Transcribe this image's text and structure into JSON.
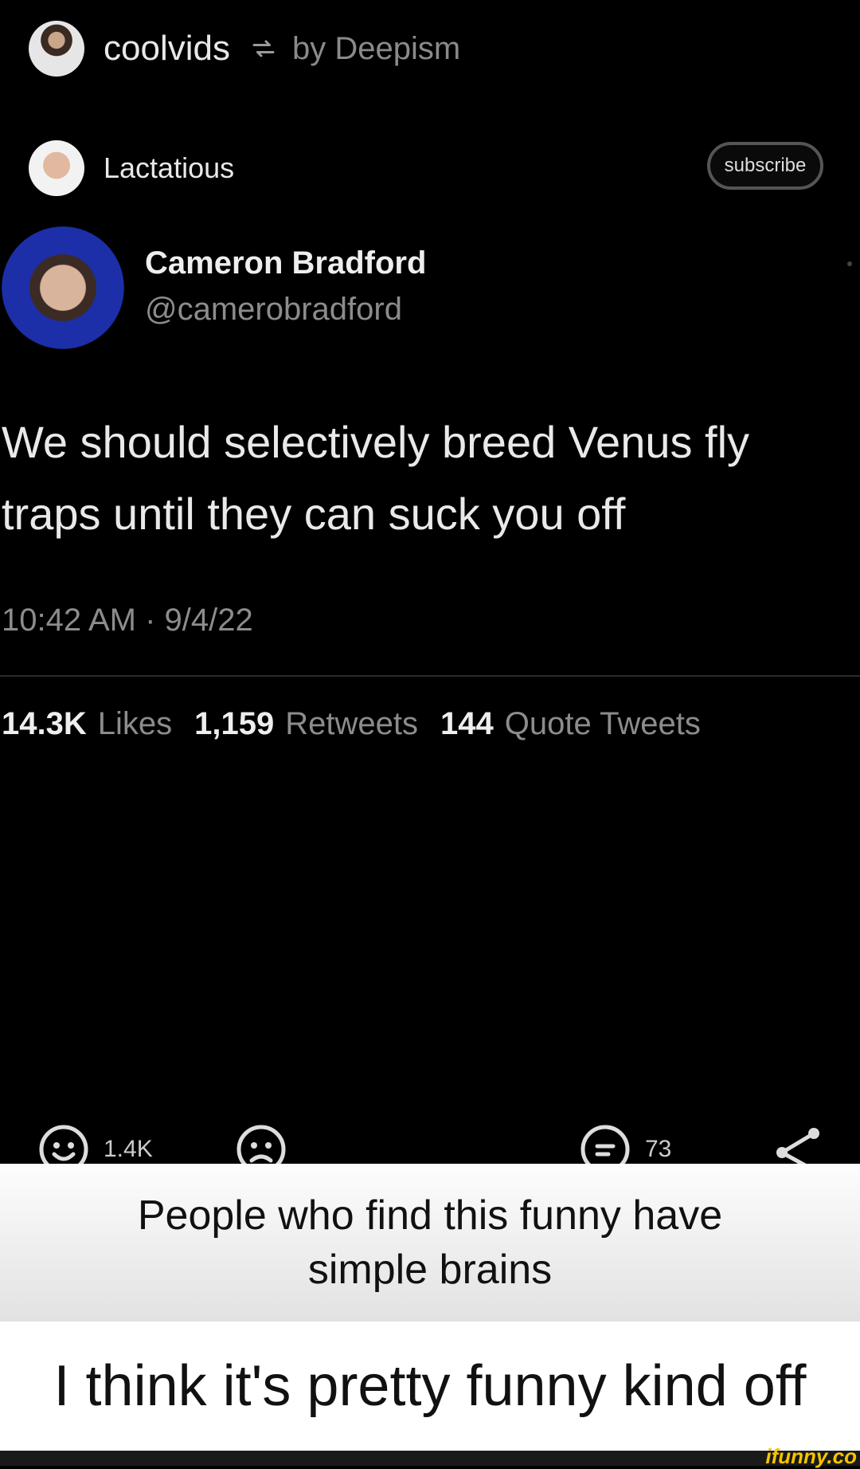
{
  "repost": {
    "user": "coolvids",
    "by_label": "by Deepism"
  },
  "author": {
    "name": "Lactatious",
    "subscribe_label": "subscribe"
  },
  "tweet": {
    "name": "Cameron Bradford",
    "handle": "@camerobradford",
    "text": "We should selectively breed Venus fly\ntraps until they can suck you off",
    "time": "10:42 AM · 9/4/22",
    "likes": "14.3K",
    "likes_label": "Likes",
    "retweets": "1,159",
    "retweets_label": "Retweets",
    "quotes": "144",
    "quotes_label": "Quote Tweets"
  },
  "actions": {
    "smile_count": "1.4K",
    "comment_count": "73"
  },
  "captions": {
    "top": "People who find this funny have\nsimple brains",
    "bottom": "I think it's pretty funny kind off"
  },
  "watermark": "ifunny.co"
}
